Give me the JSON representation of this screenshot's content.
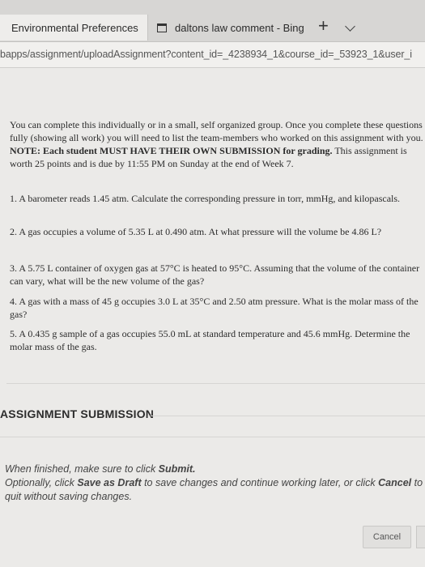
{
  "browser": {
    "tabs": [
      {
        "title": "Environmental Preferences",
        "active": true
      },
      {
        "title": "daltons law comment - Bing",
        "active": false
      }
    ],
    "new_tab_label": "+",
    "url": "bapps/assignment/uploadAssignment?content_id=_4238934_1&course_id=_53923_1&user_i"
  },
  "assignment": {
    "intro_part1": "You can complete this individually or in a small, self organized group. Once you complete these questions fully (showing all work) you will need to list the team-members who worked on this assignment with you. ",
    "intro_note_label": "NOTE:",
    "intro_bold": " Each student MUST HAVE THEIR OWN SUBMISSION for grading.",
    "intro_part2": " This assignment is worth 25 points and is due by 11:55 PM on Sunday at the end of Week 7.",
    "questions": [
      "1. A barometer reads 1.45 atm.  Calculate the corresponding pressure in torr, mmHg, and kilopascals.",
      "2.  A gas occupies a volume of 5.35 L at 0.490 atm.  At what pressure will the volume be 4.86 L?",
      "3. A 5.75 L container of oxygen gas at 57°C is heated to 95°C.  Assuming that the volume of the container can vary, what will be the new volume of the gas?",
      "4. A gas with a mass of 45 g occupies 3.0 L at 35°C and 2.50 atm pressure.  What is the molar mass of the gas?",
      "5. A 0.435 g sample of a gas occupies 55.0 mL at standard temperature and 45.6 mmHg.  Determine the molar mass of the gas."
    ]
  },
  "submission": {
    "section_title": "ASSIGNMENT SUBMISSION",
    "line1_prefix": "When finished, make sure to click ",
    "line1_action": "Submit.",
    "line2_prefix": "Optionally, click ",
    "line2_action": "Save as Draft",
    "line2_middle": " to save changes and continue working later, or click ",
    "line2_action2": "Cancel",
    "line2_suffix": " to quit without saving changes.",
    "cancel_label": "Cancel"
  }
}
